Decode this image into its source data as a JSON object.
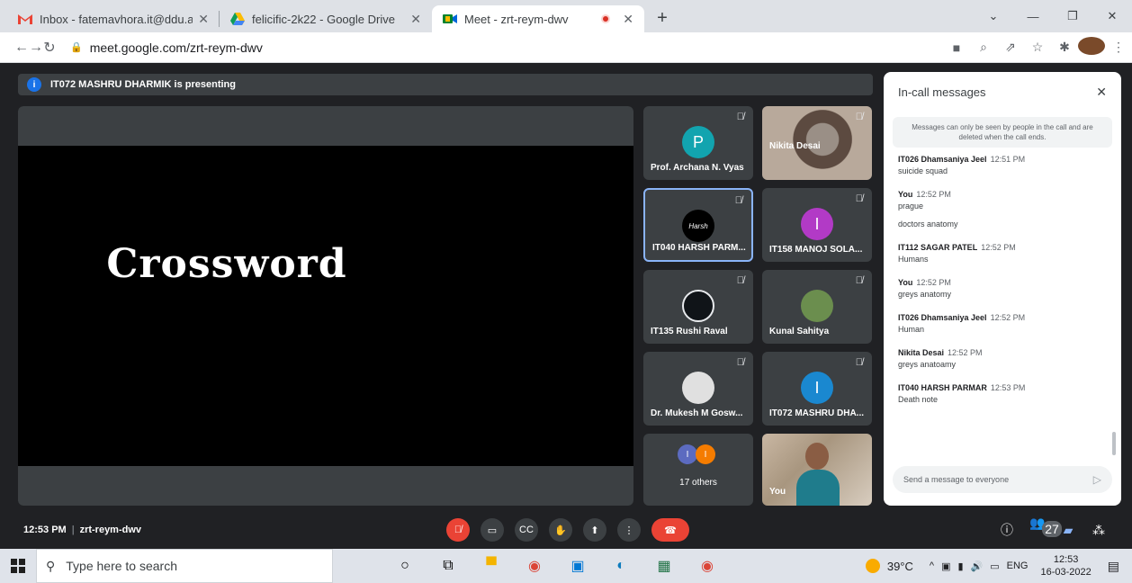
{
  "browser": {
    "tabs": [
      {
        "title": "Inbox - fatemavhora.it@ddu.ac.in",
        "close": "✕"
      },
      {
        "title": "felicific-2k22 - Google Drive",
        "close": "✕"
      },
      {
        "title": "Meet - zrt-reym-dwv",
        "close": "✕"
      }
    ],
    "new_tab": "+",
    "url": "meet.google.com/zrt-reym-dwv"
  },
  "presenting": {
    "text": "IT072 MASHRU DHARMIK is presenting",
    "icon": "i"
  },
  "stage": {
    "slide_text": "Crossword"
  },
  "participants": [
    {
      "name": "Prof. Archana N. Vyas",
      "initial": "P",
      "color": "#12a4af"
    },
    {
      "name": "Nikita Desai",
      "initial": ""
    },
    {
      "name": "IT040 HARSH PARM...",
      "initial": "Harsh",
      "color": "#000000"
    },
    {
      "name": "IT158 MANOJ SOLA...",
      "initial": "I",
      "color": "#b23ac6"
    },
    {
      "name": "IT135 Rushi Raval",
      "initial": "",
      "color": "#101418"
    },
    {
      "name": "Kunal Sahitya",
      "initial": "",
      "color": "#6b8e4e"
    },
    {
      "name": "Dr. Mukesh M Gosw...",
      "initial": "",
      "color": "#e0e0e0"
    },
    {
      "name": "IT072 MASHRU DHA...",
      "initial": "I",
      "color": "#1a88d0"
    },
    {
      "name": "17 others",
      "initial": "I"
    },
    {
      "name": "You",
      "initial": ""
    }
  ],
  "chat": {
    "title": "In-call messages",
    "close": "✕",
    "note": "Messages can only be seen by people in the call and are deleted when the call ends.",
    "messages": [
      {
        "sender": "IT026 Dhamsaniya Jeel",
        "time": "12:51 PM",
        "text": "suicide squad",
        "text2": ""
      },
      {
        "sender": "You",
        "time": "12:52 PM",
        "text": "prague",
        "text2": "doctors anatomy"
      },
      {
        "sender": "IT112 SAGAR PATEL",
        "time": "12:52 PM",
        "text": "Humans",
        "text2": ""
      },
      {
        "sender": "You",
        "time": "12:52 PM",
        "text": "greys anatomy",
        "text2": ""
      },
      {
        "sender": "IT026 Dhamsaniya Jeel",
        "time": "12:52 PM",
        "text": "Human",
        "text2": ""
      },
      {
        "sender": "Nikita Desai",
        "time": "12:52 PM",
        "text": "greys anatoamy",
        "text2": ""
      },
      {
        "sender": "IT040 HARSH PARMAR",
        "time": "12:53 PM",
        "text": "Death note",
        "text2": ""
      }
    ],
    "input_placeholder": "Send a message to everyone"
  },
  "bottom": {
    "time": "12:53 PM",
    "meeting_code": "zrt-reym-dwv",
    "people_count": "27"
  },
  "taskbar": {
    "search_placeholder": "Type here to search",
    "temperature": "39°C",
    "language": "ENG",
    "clock_time": "12:53",
    "clock_date": "16-03-2022"
  }
}
